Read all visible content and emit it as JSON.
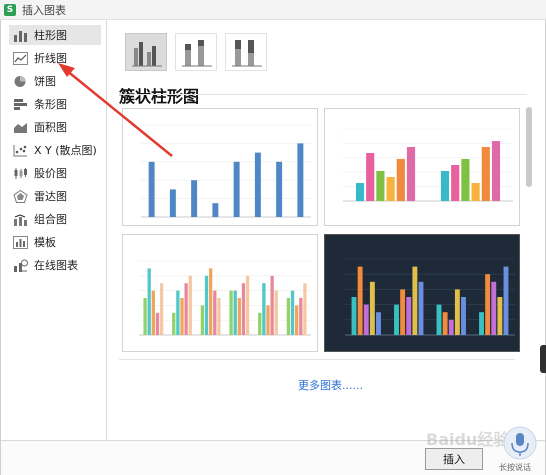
{
  "window": {
    "title": "插入图表",
    "app_icon_letter": "S"
  },
  "sidebar": {
    "items": [
      {
        "label": "柱形图",
        "icon": "column-chart-icon",
        "active": true
      },
      {
        "label": "折线图",
        "icon": "line-chart-icon",
        "active": false
      },
      {
        "label": "饼图",
        "icon": "pie-chart-icon",
        "active": false
      },
      {
        "label": "条形图",
        "icon": "bar-chart-icon",
        "active": false
      },
      {
        "label": "面积图",
        "icon": "area-chart-icon",
        "active": false
      },
      {
        "label": "X Y (散点图)",
        "icon": "scatter-chart-icon",
        "active": false
      },
      {
        "label": "股价图",
        "icon": "stock-chart-icon",
        "active": false
      },
      {
        "label": "雷达图",
        "icon": "radar-chart-icon",
        "active": false
      },
      {
        "label": "组合图",
        "icon": "combo-chart-icon",
        "active": false
      },
      {
        "label": "模板",
        "icon": "template-icon",
        "active": false
      },
      {
        "label": "在线图表",
        "icon": "online-chart-icon",
        "active": false
      }
    ]
  },
  "main": {
    "subtypes": [
      "clustered-column",
      "stacked-column",
      "percent-stacked-column"
    ],
    "section_title": "簇状柱形图",
    "more_link": "更多图表......"
  },
  "thumbnails": [
    {
      "title": "",
      "style": "light",
      "chart_data": {
        "type": "bar",
        "values": [
          6,
          3,
          4,
          1.5,
          6,
          7,
          6,
          8
        ],
        "ylim": [
          0,
          10
        ],
        "color": "#4f86c6"
      }
    },
    {
      "title": "",
      "style": "light",
      "chart_data": {
        "type": "bar",
        "series": [
          {
            "values": [
              3,
              5
            ],
            "color": "#39b9c8"
          },
          {
            "values": [
              8,
              6
            ],
            "color": "#e8609e"
          },
          {
            "values": [
              5,
              7
            ],
            "color": "#7dc243"
          },
          {
            "values": [
              4,
              3
            ],
            "color": "#f7b240"
          },
          {
            "values": [
              7,
              9
            ],
            "color": "#f08b3e"
          },
          {
            "values": [
              9,
              10
            ],
            "color": "#e06aa8"
          }
        ],
        "ylim": [
          0,
          12
        ]
      }
    },
    {
      "title": "",
      "style": "light",
      "chart_data": {
        "type": "bar",
        "series": [
          {
            "values": [
              5,
              3,
              4,
              6,
              3,
              5
            ],
            "color": "#8fd36a"
          },
          {
            "values": [
              9,
              6,
              8,
              6,
              7,
              6
            ],
            "color": "#52c7c7"
          },
          {
            "values": [
              6,
              5,
              9,
              5,
              4,
              4
            ],
            "color": "#f2a45c"
          },
          {
            "values": [
              3,
              7,
              6,
              7,
              8,
              5
            ],
            "color": "#e7899b"
          },
          {
            "values": [
              7,
              8,
              5,
              8,
              6,
              7
            ],
            "color": "#f5c7a3"
          }
        ],
        "ylim": [
          0,
          10
        ]
      }
    },
    {
      "title": "",
      "style": "dark",
      "chart_data": {
        "type": "bar",
        "series": [
          {
            "values": [
              5,
              4,
              4,
              3
            ],
            "color": "#39c0c0"
          },
          {
            "values": [
              9,
              6,
              3,
              8
            ],
            "color": "#f28b3e"
          },
          {
            "values": [
              4,
              5,
              2,
              7
            ],
            "color": "#c46fd6"
          },
          {
            "values": [
              7,
              9,
              6,
              5
            ],
            "color": "#e0c04a"
          },
          {
            "values": [
              3,
              7,
              5,
              9
            ],
            "color": "#6a8fe0"
          }
        ],
        "ylim": [
          0,
          10
        ]
      }
    }
  ],
  "footer": {
    "insert_label": "插入"
  },
  "overlay": {
    "voice_label": "长按说话",
    "watermark": "Baidu经验"
  },
  "colors": {
    "accent_arrow": "#e23a2e",
    "link": "#2f6fd6"
  }
}
